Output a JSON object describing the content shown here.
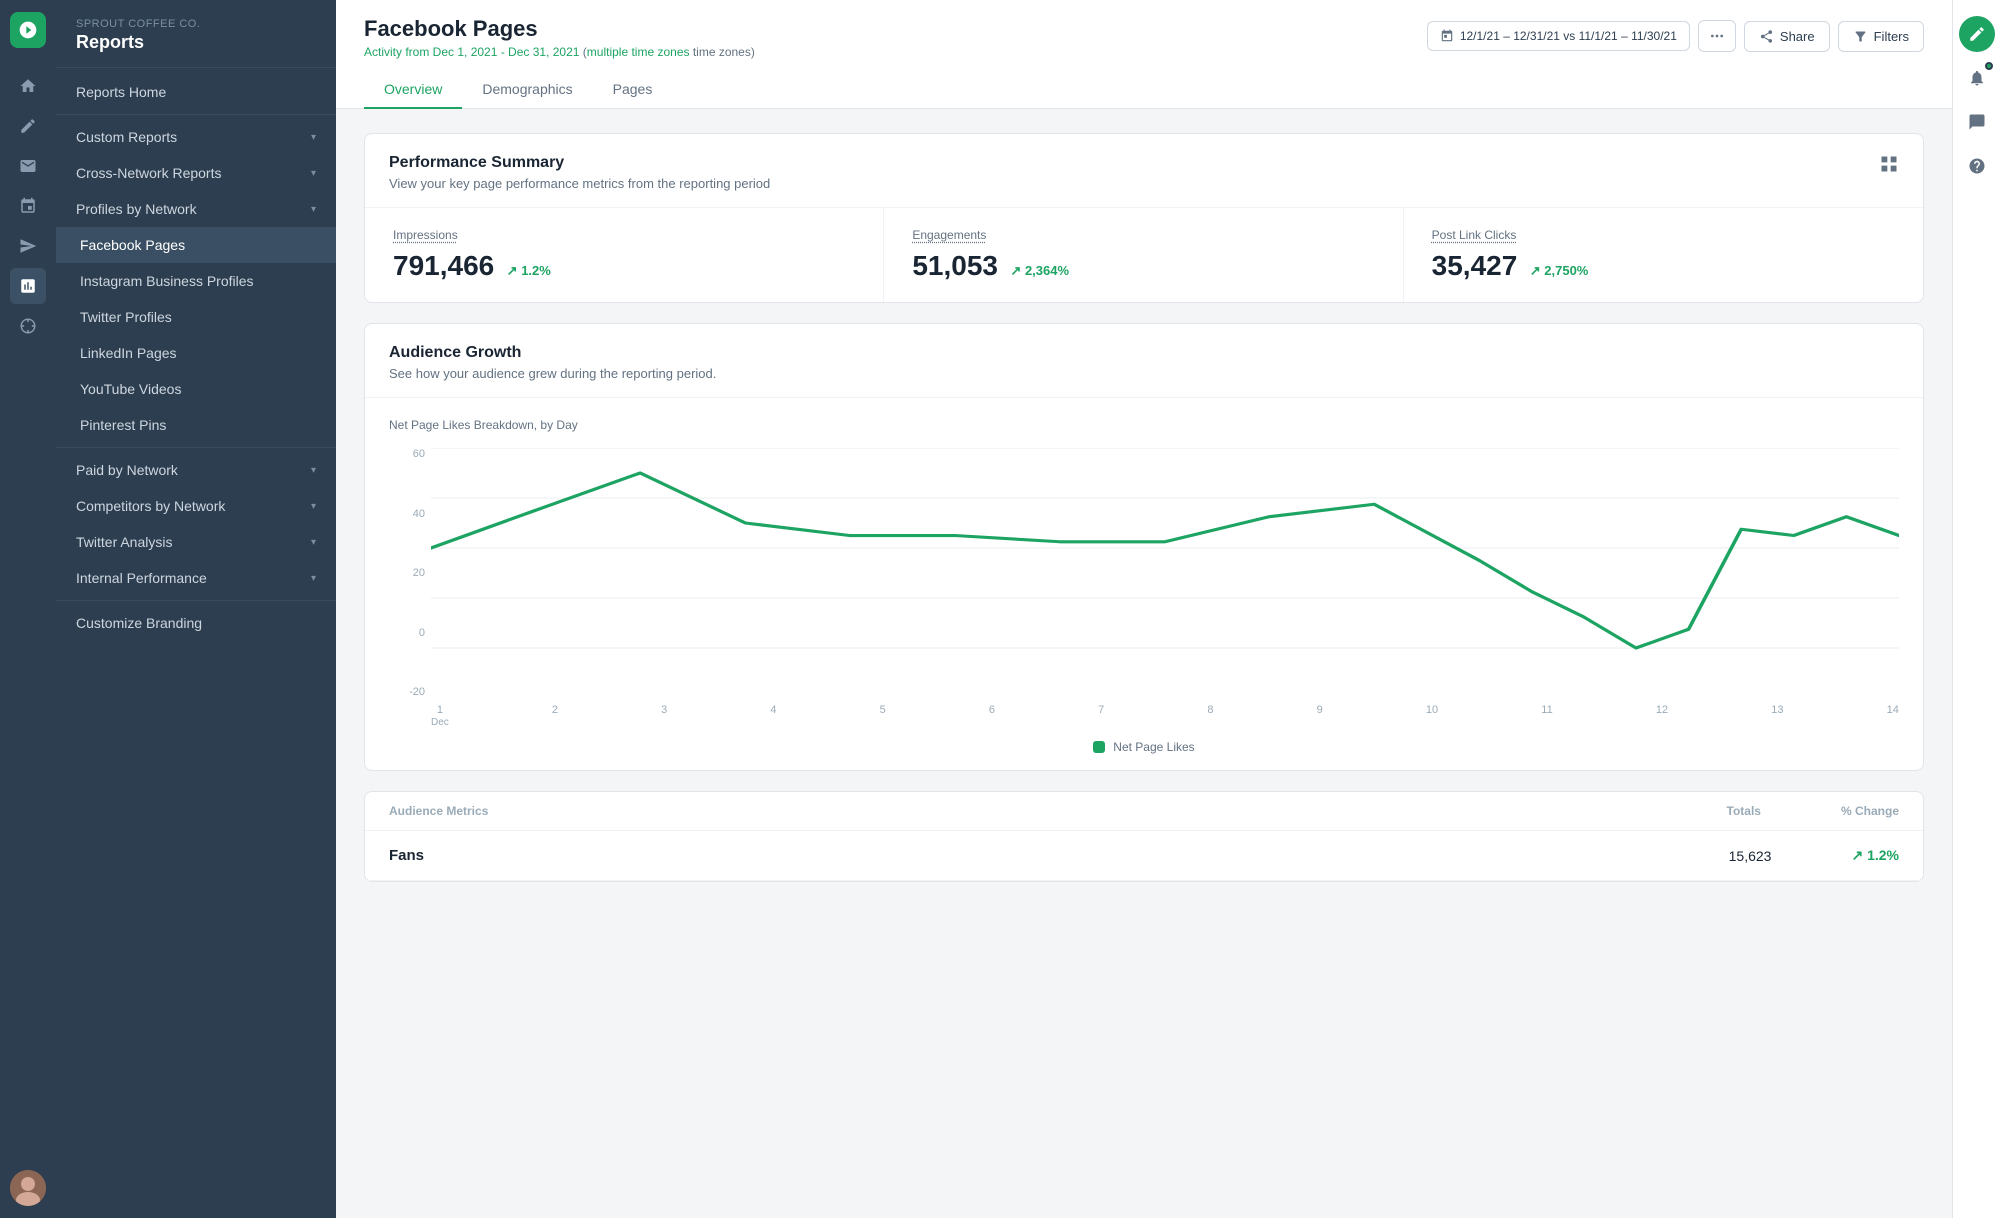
{
  "brand": {
    "company": "Sprout Coffee Co.",
    "app_title": "Reports"
  },
  "sidebar": {
    "items": [
      {
        "id": "reports-home",
        "label": "Reports Home",
        "has_chevron": false
      },
      {
        "id": "custom-reports",
        "label": "Custom Reports",
        "has_chevron": true
      },
      {
        "id": "cross-network",
        "label": "Cross-Network Reports",
        "has_chevron": true
      },
      {
        "id": "profiles-by-network",
        "label": "Profiles by Network",
        "has_chevron": true
      },
      {
        "id": "facebook-pages",
        "label": "Facebook Pages",
        "is_sub": true,
        "active": true
      },
      {
        "id": "instagram-business",
        "label": "Instagram Business Profiles",
        "is_sub": true
      },
      {
        "id": "twitter-profiles",
        "label": "Twitter Profiles",
        "is_sub": true
      },
      {
        "id": "linkedin-pages",
        "label": "LinkedIn Pages",
        "is_sub": true
      },
      {
        "id": "youtube-videos",
        "label": "YouTube Videos",
        "is_sub": true
      },
      {
        "id": "pinterest-pins",
        "label": "Pinterest Pins",
        "is_sub": true
      },
      {
        "id": "paid-by-network",
        "label": "Paid by Network",
        "has_chevron": true
      },
      {
        "id": "competitors-by-network",
        "label": "Competitors by Network",
        "has_chevron": true
      },
      {
        "id": "twitter-analysis",
        "label": "Twitter Analysis",
        "has_chevron": true
      },
      {
        "id": "internal-performance",
        "label": "Internal Performance",
        "has_chevron": true
      },
      {
        "id": "customize-branding",
        "label": "Customize Branding",
        "has_chevron": false
      }
    ]
  },
  "page": {
    "title": "Facebook Pages",
    "subtitle": "Activity from Dec 1, 2021 - Dec 31, 2021",
    "subtitle_link": "multiple time zones",
    "date_range": "12/1/21 – 12/31/21 vs 11/1/21 – 11/30/21",
    "tabs": [
      {
        "id": "overview",
        "label": "Overview",
        "active": true
      },
      {
        "id": "demographics",
        "label": "Demographics"
      },
      {
        "id": "pages",
        "label": "Pages"
      }
    ]
  },
  "performance_summary": {
    "title": "Performance Summary",
    "subtitle": "View your key page performance metrics from the reporting period",
    "metrics": [
      {
        "label": "Impressions",
        "value": "791,466",
        "change": "1.2%",
        "direction": "up"
      },
      {
        "label": "Engagements",
        "value": "51,053",
        "change": "2,364%",
        "direction": "up"
      },
      {
        "label": "Post Link Clicks",
        "value": "35,427",
        "change": "2,750%",
        "direction": "up"
      }
    ]
  },
  "audience_growth": {
    "title": "Audience Growth",
    "subtitle": "See how your audience grew during the reporting period.",
    "chart_label": "Net Page Likes Breakdown, by Day",
    "y_axis": [
      "60",
      "40",
      "20",
      "0",
      "-20"
    ],
    "x_axis": [
      {
        "day": "1",
        "label": "Dec"
      },
      {
        "day": "2"
      },
      {
        "day": "3"
      },
      {
        "day": "4"
      },
      {
        "day": "5"
      },
      {
        "day": "6"
      },
      {
        "day": "7"
      },
      {
        "day": "8"
      },
      {
        "day": "9"
      },
      {
        "day": "10"
      },
      {
        "day": "11"
      },
      {
        "day": "12"
      },
      {
        "day": "13"
      },
      {
        "day": "14"
      }
    ],
    "legend": "Net Page Likes"
  },
  "audience_metrics": {
    "title": "Audience Metrics",
    "columns": [
      "Totals",
      "% Change"
    ],
    "rows": [
      {
        "label": "Fans",
        "total": "15,623",
        "change": "1.2%"
      }
    ]
  },
  "buttons": {
    "share": "Share",
    "filters": "Filters"
  }
}
